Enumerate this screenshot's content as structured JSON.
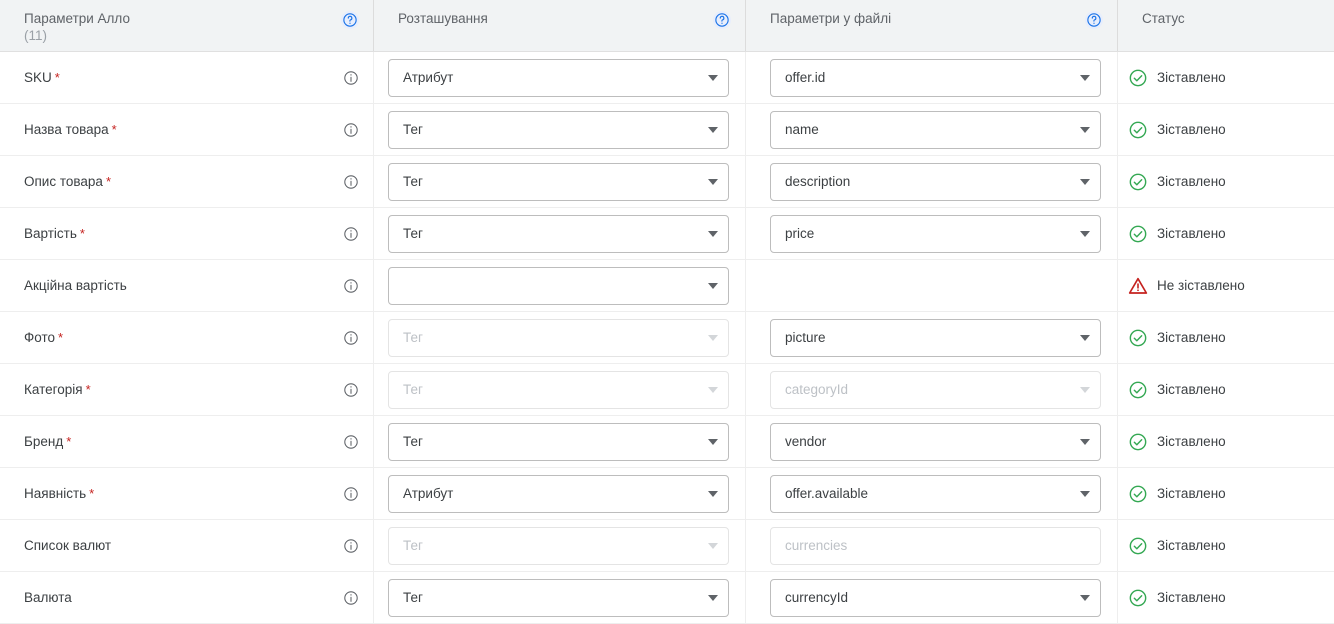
{
  "header": {
    "columns": [
      {
        "title": "Параметри Алло",
        "count": "(11)",
        "help": "help-icon",
        "has_help": true
      },
      {
        "title": "Розташування",
        "count": "",
        "help": "help-icon",
        "has_help": true
      },
      {
        "title": "Параметри у файлі",
        "count": "",
        "help": "help-icon",
        "has_help": true
      },
      {
        "title": "Статус",
        "count": "",
        "help": "",
        "has_help": false
      }
    ]
  },
  "colors": {
    "header_bg": "#f1f3f4",
    "success": "#34a853",
    "error": "#c5221f",
    "required_star": "#c5221f",
    "help_icon": "#1a73e8",
    "text": "#3c4043",
    "muted_text": "#9aa0a6",
    "disabled_text": "#bdc1c6",
    "border": "#bdbdbd",
    "row_divider": "#eeeeee"
  },
  "status_labels": {
    "mapped": "Зіставлено",
    "unmapped": "Не зіставлено"
  },
  "rows": [
    {
      "param": "SKU",
      "required": true,
      "location": {
        "value": "Атрибут",
        "disabled": false,
        "caret": true
      },
      "file_param": {
        "value": "offer.id",
        "disabled": false,
        "caret": true
      },
      "status": {
        "label": "Зіставлено",
        "state": "mapped",
        "icon": "check-circle-icon"
      }
    },
    {
      "param": "Назва товара",
      "required": true,
      "location": {
        "value": "Тег",
        "disabled": false,
        "caret": true
      },
      "file_param": {
        "value": "name",
        "disabled": false,
        "caret": true
      },
      "status": {
        "label": "Зіставлено",
        "state": "mapped",
        "icon": "check-circle-icon"
      }
    },
    {
      "param": "Опис товара",
      "required": true,
      "location": {
        "value": "Тег",
        "disabled": false,
        "caret": true
      },
      "file_param": {
        "value": "description",
        "disabled": false,
        "caret": true
      },
      "status": {
        "label": "Зіставлено",
        "state": "mapped",
        "icon": "check-circle-icon"
      }
    },
    {
      "param": "Вартість",
      "required": true,
      "location": {
        "value": "Тег",
        "disabled": false,
        "caret": true
      },
      "file_param": {
        "value": "price",
        "disabled": false,
        "caret": true
      },
      "status": {
        "label": "Зіставлено",
        "state": "mapped",
        "icon": "check-circle-icon"
      }
    },
    {
      "param": "Акційна вартість",
      "required": false,
      "location": {
        "value": "",
        "disabled": false,
        "caret": true
      },
      "file_param": null,
      "status": {
        "label": "Не зіставлено",
        "state": "unmapped",
        "icon": "warning-triangle-icon"
      }
    },
    {
      "param": "Фото",
      "required": true,
      "location": {
        "value": "Тег",
        "disabled": true,
        "caret": true
      },
      "file_param": {
        "value": "picture",
        "disabled": false,
        "caret": true
      },
      "status": {
        "label": "Зіставлено",
        "state": "mapped",
        "icon": "check-circle-icon"
      }
    },
    {
      "param": "Категорія",
      "required": true,
      "location": {
        "value": "Тег",
        "disabled": true,
        "caret": true
      },
      "file_param": {
        "value": "categoryId",
        "disabled": true,
        "caret": true
      },
      "status": {
        "label": "Зіставлено",
        "state": "mapped",
        "icon": "check-circle-icon"
      }
    },
    {
      "param": "Бренд",
      "required": true,
      "location": {
        "value": "Тег",
        "disabled": false,
        "caret": true
      },
      "file_param": {
        "value": "vendor",
        "disabled": false,
        "caret": true
      },
      "status": {
        "label": "Зіставлено",
        "state": "mapped",
        "icon": "check-circle-icon"
      }
    },
    {
      "param": "Наявність",
      "required": true,
      "location": {
        "value": "Атрибут",
        "disabled": false,
        "caret": true
      },
      "file_param": {
        "value": "offer.available",
        "disabled": false,
        "caret": true
      },
      "status": {
        "label": "Зіставлено",
        "state": "mapped",
        "icon": "check-circle-icon"
      }
    },
    {
      "param": "Список валют",
      "required": false,
      "location": {
        "value": "Тег",
        "disabled": true,
        "caret": true
      },
      "file_param": {
        "value": "currencies",
        "disabled": true,
        "caret": false
      },
      "status": {
        "label": "Зіставлено",
        "state": "mapped",
        "icon": "check-circle-icon"
      }
    },
    {
      "param": "Валюта",
      "required": false,
      "location": {
        "value": "Тег",
        "disabled": false,
        "caret": true
      },
      "file_param": {
        "value": "currencyId",
        "disabled": false,
        "caret": true
      },
      "status": {
        "label": "Зіставлено",
        "state": "mapped",
        "icon": "check-circle-icon"
      }
    }
  ]
}
